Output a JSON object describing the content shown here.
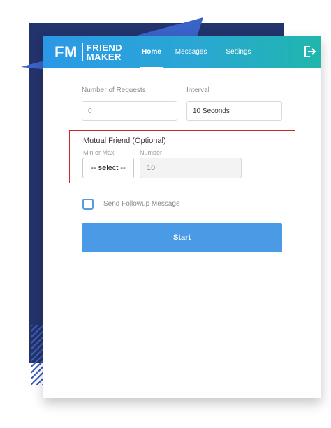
{
  "brand": {
    "fm": "FM",
    "line1": "FRIEND",
    "line2": "MAKER"
  },
  "nav": {
    "home": "Home",
    "messages": "Messages",
    "settings": "Settings",
    "active": "Home"
  },
  "form": {
    "requests_label": "Number of Requests",
    "requests_value": "0",
    "interval_label": "Interval",
    "interval_value": "10 Seconds",
    "mutual": {
      "title": "Mutual Friend (Optional)",
      "min_max_label": "Min or Max",
      "select_value": "-- select --",
      "number_label": "Number",
      "number_value": "10"
    },
    "followup_label": "Send Followup Message",
    "followup_checked": false,
    "start_label": "Start"
  },
  "colors": {
    "header_start": "#2b98e6",
    "header_end": "#20b6ac",
    "button": "#4a9ae5",
    "highlight_border": "#c9262d",
    "background_panel": "#23336b"
  },
  "icons": {
    "logout": "logout-icon"
  }
}
